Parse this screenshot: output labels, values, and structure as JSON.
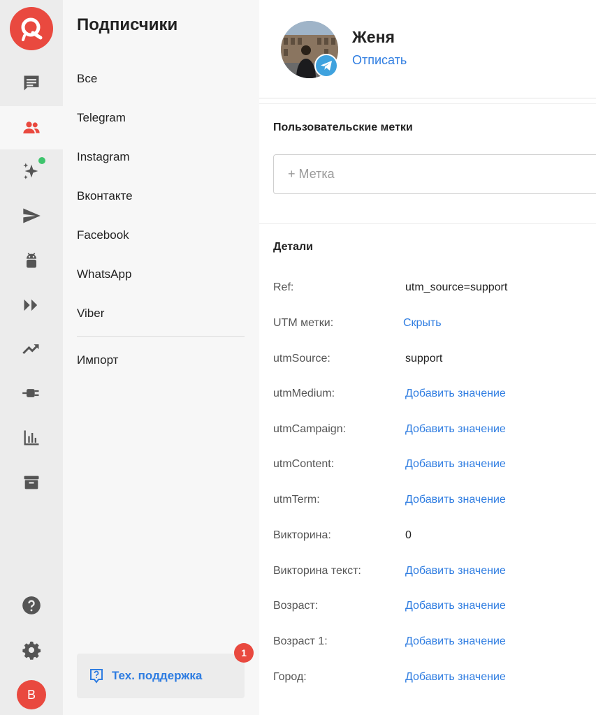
{
  "rail": {
    "icons": [
      "app-logo-icon",
      "messages-icon",
      "subscribers-icon",
      "sparkles-icon",
      "send-icon",
      "bot-icon",
      "flows-icon",
      "trend-icon",
      "integrations-plug-icon",
      "stats-icon",
      "archive-icon",
      "help-icon",
      "settings-icon"
    ],
    "user_initial": "B",
    "active_color": "#e9493f",
    "notification_dot_color": "#3ec46d"
  },
  "subnav": {
    "title": "Подписчики",
    "items": [
      {
        "label": "Все"
      },
      {
        "label": "Telegram"
      },
      {
        "label": "Instagram"
      },
      {
        "label": "Вконтакте"
      },
      {
        "label": "Facebook"
      },
      {
        "label": "WhatsApp"
      },
      {
        "label": "Viber"
      }
    ],
    "import_label": "Импорт",
    "support_label": "Тех. поддержка",
    "support_badge": "1"
  },
  "profile": {
    "name": "Женя",
    "unsubscribe_label": "Отписать",
    "channel_icon": "telegram-icon"
  },
  "tags": {
    "title": "Пользовательские метки",
    "placeholder": "+ Метка"
  },
  "details": {
    "title": "Детали",
    "rows": [
      {
        "label": "Ref:",
        "value": "utm_source=support"
      },
      {
        "label": "UTM метки:",
        "value": "Скрыть"
      },
      {
        "label": "utmSource:",
        "value": "support"
      },
      {
        "label": "utmMedium:",
        "value": "Добавить значение"
      },
      {
        "label": "utmCampaign:",
        "value": "Добавить значение"
      },
      {
        "label": "utmContent:",
        "value": "Добавить значение"
      },
      {
        "label": "utmTerm:",
        "value": "Добавить значение"
      },
      {
        "label": "Викторина:",
        "value": "0"
      },
      {
        "label": "Викторина текст:",
        "value": "Добавить значение"
      },
      {
        "label": "Возраст:",
        "value": "Добавить значение"
      },
      {
        "label": "Возраст 1:",
        "value": "Добавить значение"
      },
      {
        "label": "Город:",
        "value": "Добавить значение"
      }
    ]
  },
  "colors": {
    "brand": "#e9493f",
    "link": "#2f7de1",
    "telegram": "#3fa2de"
  }
}
